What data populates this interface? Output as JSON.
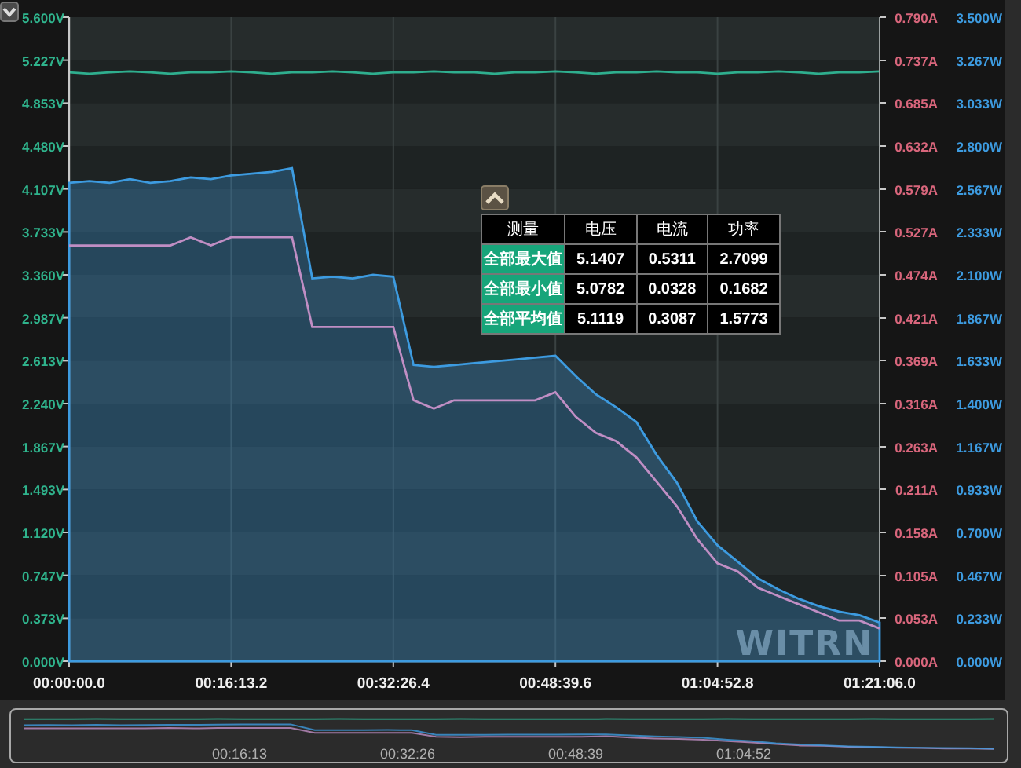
{
  "chart": {
    "logo": "WITRN",
    "voltage_chart": {
      "chart_data": {
        "type": "line",
        "categories": [
          "00:00:00.0",
          null,
          null,
          null,
          null,
          null,
          null,
          null,
          "00:16:13.2",
          null,
          null,
          null,
          null,
          null,
          null,
          null,
          "00:32:26.4",
          null,
          null,
          null,
          null,
          null,
          null,
          null,
          "00:48:39.6",
          null,
          null,
          null,
          null,
          null,
          null,
          null,
          "01:04:52.8",
          null,
          null,
          null,
          null,
          null,
          null,
          null,
          "01:21:06.0"
        ],
        "ylim": [
          0,
          5.6
        ],
        "grid": true,
        "yticks": [
          {
            "value": 0,
            "label": "0.000V"
          },
          {
            "value": 0.373,
            "label": "0.373V"
          },
          {
            "value": 0.747,
            "label": "0.747V"
          },
          {
            "value": 1.12,
            "label": "1.120V"
          },
          {
            "value": 1.493,
            "label": "1.493V"
          },
          {
            "value": 1.867,
            "label": "1.867V"
          },
          {
            "value": 2.24,
            "label": "2.240V"
          },
          {
            "value": 2.613,
            "label": "2.613V"
          },
          {
            "value": 2.987,
            "label": "2.987V"
          },
          {
            "value": 3.36,
            "label": "3.360V"
          },
          {
            "value": 3.733,
            "label": "3.733V"
          },
          {
            "value": 4.107,
            "label": "4.107V"
          },
          {
            "value": 4.48,
            "label": "4.480V"
          },
          {
            "value": 4.853,
            "label": "4.853V"
          },
          {
            "value": 5.227,
            "label": "5.227V"
          },
          {
            "value": 5.6,
            "label": "5.600V"
          }
        ],
        "series": [
          {
            "color": "#2fae8e",
            "values": [
              5.12,
              5.11,
              5.12,
              5.13,
              5.12,
              5.11,
              5.12,
              5.12,
              5.13,
              5.12,
              5.11,
              5.12,
              5.12,
              5.13,
              5.12,
              5.11,
              5.12,
              5.12,
              5.13,
              5.12,
              5.12,
              5.11,
              5.12,
              5.12,
              5.13,
              5.12,
              5.11,
              5.12,
              5.12,
              5.13,
              5.12,
              5.12,
              5.11,
              5.12,
              5.12,
              5.13,
              5.12,
              5.11,
              5.12,
              5.12,
              5.13
            ]
          }
        ]
      }
    },
    "current_chart": {
      "chart_data": {
        "type": "line",
        "categories": [
          null,
          null,
          null,
          null,
          null,
          null,
          null,
          null,
          null,
          null,
          null,
          null,
          null,
          null,
          null,
          null,
          null,
          null,
          null,
          null,
          null,
          null,
          null,
          null,
          null,
          null,
          null,
          null,
          null,
          null,
          null,
          null,
          null,
          null,
          null,
          null,
          null,
          null,
          null,
          null,
          null
        ],
        "ylim": [
          0,
          0.79
        ],
        "yticks": [
          {
            "value": 0.79,
            "label": "0.790A"
          },
          {
            "value": 0.737,
            "label": "0.737A"
          },
          {
            "value": 0.685,
            "label": "0.685A"
          },
          {
            "value": 0.632,
            "label": "0.632A"
          },
          {
            "value": 0.579,
            "label": "0.579A"
          },
          {
            "value": 0.527,
            "label": "0.527A"
          },
          {
            "value": 0.474,
            "label": "0.474A"
          },
          {
            "value": 0.421,
            "label": "0.421A"
          },
          {
            "value": 0.369,
            "label": "0.369A"
          },
          {
            "value": 0.316,
            "label": "0.316A"
          },
          {
            "value": 0.263,
            "label": "0.263A"
          },
          {
            "value": 0.211,
            "label": "0.211A"
          },
          {
            "value": 0.158,
            "label": "0.158A"
          },
          {
            "value": 0.105,
            "label": "0.105A"
          },
          {
            "value": 0.053,
            "label": "0.053A"
          },
          {
            "value": 0,
            "label": "0.000A"
          }
        ],
        "series": [
          {
            "color": "#c08ec4",
            "values": [
              0.51,
              0.51,
              0.51,
              0.51,
              0.51,
              0.51,
              0.52,
              0.51,
              0.52,
              0.52,
              0.52,
              0.52,
              0.41,
              0.41,
              0.41,
              0.41,
              0.41,
              0.32,
              0.31,
              0.32,
              0.32,
              0.32,
              0.32,
              0.32,
              0.33,
              0.3,
              0.28,
              0.27,
              0.25,
              0.22,
              0.19,
              0.15,
              0.12,
              0.11,
              0.09,
              0.08,
              0.07,
              0.06,
              0.05,
              0.05,
              0.04
            ]
          }
        ]
      }
    },
    "power_chart": {
      "chart_data": {
        "type": "area",
        "categories": [
          null,
          null,
          null,
          null,
          null,
          null,
          null,
          null,
          null,
          null,
          null,
          null,
          null,
          null,
          null,
          null,
          null,
          null,
          null,
          null,
          null,
          null,
          null,
          null,
          null,
          null,
          null,
          null,
          null,
          null,
          null,
          null,
          null,
          null,
          null,
          null,
          null,
          null,
          null,
          null,
          null
        ],
        "ylim": [
          0,
          3.5
        ],
        "yticks": [
          {
            "value": 3.5,
            "label": "3.500W"
          },
          {
            "value": 3.267,
            "label": "3.267W"
          },
          {
            "value": 3.033,
            "label": "3.033W"
          },
          {
            "value": 2.8,
            "label": "2.800W"
          },
          {
            "value": 2.567,
            "label": "2.567W"
          },
          {
            "value": 2.333,
            "label": "2.333W"
          },
          {
            "value": 2.1,
            "label": "2.100W"
          },
          {
            "value": 1.867,
            "label": "1.867W"
          },
          {
            "value": 1.633,
            "label": "1.633W"
          },
          {
            "value": 1.4,
            "label": "1.400W"
          },
          {
            "value": 1.167,
            "label": "1.167W"
          },
          {
            "value": 0.933,
            "label": "0.933W"
          },
          {
            "value": 0.7,
            "label": "0.700W"
          },
          {
            "value": 0.467,
            "label": "0.467W"
          },
          {
            "value": 0.233,
            "label": "0.233W"
          },
          {
            "value": 0,
            "label": "0.000W"
          }
        ],
        "series": [
          {
            "color": "#3d9be0",
            "values": [
              2.6,
              2.61,
              2.6,
              2.62,
              2.6,
              2.61,
              2.63,
              2.62,
              2.64,
              2.65,
              2.66,
              2.68,
              2.08,
              2.09,
              2.08,
              2.1,
              2.09,
              1.61,
              1.6,
              1.61,
              1.62,
              1.63,
              1.64,
              1.65,
              1.66,
              1.55,
              1.45,
              1.38,
              1.3,
              1.12,
              0.97,
              0.76,
              0.63,
              0.54,
              0.45,
              0.39,
              0.34,
              0.3,
              0.27,
              0.25,
              0.21
            ]
          }
        ]
      }
    }
  },
  "stats": {
    "columns": [
      "测量",
      "电压",
      "电流",
      "功率"
    ],
    "rows": [
      {
        "label": "全部最大值",
        "values": [
          "5.1407",
          "0.5311",
          "2.7099"
        ]
      },
      {
        "label": "全部最小值",
        "values": [
          "5.0782",
          "0.0328",
          "0.1682"
        ]
      },
      {
        "label": "全部平均值",
        "values": [
          "5.1119",
          "0.3087",
          "1.5773"
        ]
      }
    ]
  },
  "overview": {
    "labels": [
      "00:16:13",
      "00:32:26",
      "00:48:39",
      "01:04:52"
    ]
  }
}
